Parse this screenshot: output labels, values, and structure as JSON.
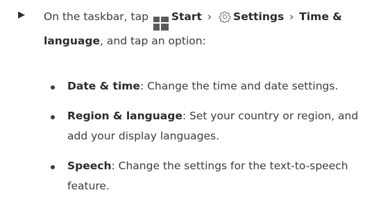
{
  "instruction": {
    "arrow_glyph": "▶",
    "prefix": "On the taskbar, tap",
    "start_icon": "windows-start-icon",
    "start_label": "Start",
    "separator": "›",
    "settings_icon": "gear-icon",
    "settings_label": "Settings",
    "time_language_label": "Time & language",
    "suffix": ", and tap an option:"
  },
  "options": [
    {
      "title": "Date & time",
      "description": ": Change the time and date settings."
    },
    {
      "title": "Region & language",
      "description": ": Set your country or region, and add your display languages."
    },
    {
      "title": "Speech",
      "description": ": Change the settings for the text-to-speech feature."
    }
  ],
  "colors": {
    "text": "#3c3c3c",
    "bold_text": "#2b2b2b",
    "icon": "#5a5a5a"
  }
}
